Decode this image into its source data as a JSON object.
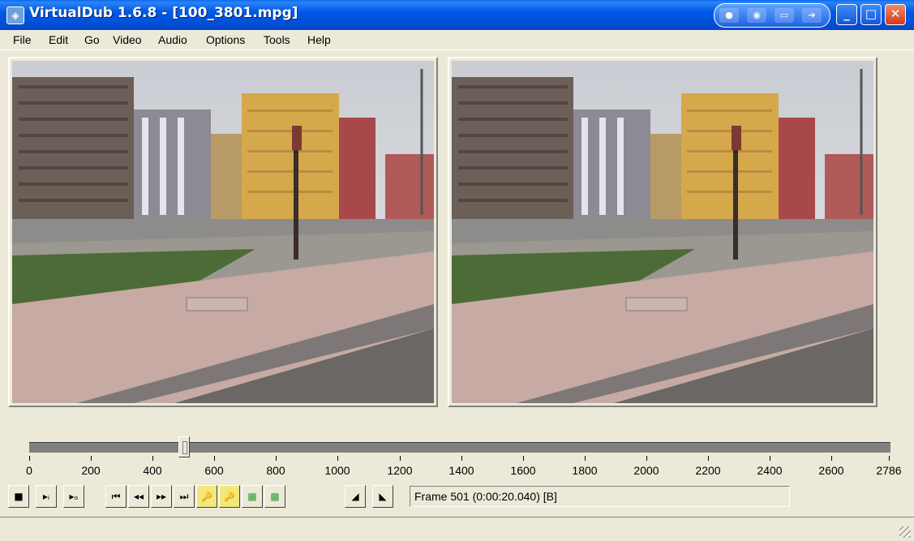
{
  "window": {
    "title": "VirtualDub 1.6.8 - [100_3801.mpg]",
    "icon": "virtualdub-app-icon",
    "controls": [
      "minimize-icon",
      "maximize-icon",
      "close-icon"
    ]
  },
  "menu": {
    "items": [
      {
        "label": "File"
      },
      {
        "label": "Edit"
      },
      {
        "label": "Go"
      },
      {
        "label": "Video"
      },
      {
        "label": "Audio"
      },
      {
        "label": "Options"
      },
      {
        "label": "Tools"
      },
      {
        "label": "Help"
      }
    ]
  },
  "panes": {
    "input": {
      "content": "input-video-frame"
    },
    "output": {
      "content": "output-video-frame"
    }
  },
  "timeline": {
    "max": 2786,
    "current_frame": 501,
    "tick_labels": [
      "0",
      "200",
      "400",
      "600",
      "800",
      "1000",
      "1200",
      "1400",
      "1600",
      "1800",
      "2000",
      "2200",
      "2400",
      "2600",
      "2786"
    ]
  },
  "toolbar": {
    "buttons": [
      {
        "name": "stop-button",
        "icon": "stop-icon",
        "glyph": "■"
      },
      {
        "name": "play-input-button",
        "icon": "play-input-icon",
        "glyph": "▸ᵢ"
      },
      {
        "name": "play-output-button",
        "icon": "play-output-icon",
        "glyph": "▸ₒ"
      },
      {
        "name": "start-button",
        "icon": "go-to-start-icon",
        "glyph": "⏮"
      },
      {
        "name": "prev-frame-button",
        "icon": "previous-frame-icon",
        "glyph": "◂◂"
      },
      {
        "name": "next-frame-button",
        "icon": "next-frame-icon",
        "glyph": "▸▸"
      },
      {
        "name": "end-button",
        "icon": "go-to-end-icon",
        "glyph": "⏭"
      },
      {
        "name": "prev-keyframe-button",
        "icon": "previous-keyframe-icon",
        "glyph": "🔑"
      },
      {
        "name": "next-keyframe-button",
        "icon": "next-keyframe-icon",
        "glyph": "🔑"
      },
      {
        "name": "prev-scene-button",
        "icon": "previous-scene-icon",
        "glyph": "▩"
      },
      {
        "name": "next-scene-button",
        "icon": "next-scene-icon",
        "glyph": "▩"
      },
      {
        "name": "mark-in-button",
        "icon": "mark-in-icon",
        "glyph": "◢"
      },
      {
        "name": "mark-out-button",
        "icon": "mark-out-icon",
        "glyph": "◣"
      }
    ],
    "frame_readout": "Frame 501 (0:00:20.040) [B]"
  },
  "colors": {
    "titlebar": "#0058e6",
    "face": "#ece9d8",
    "track": "#808080"
  }
}
